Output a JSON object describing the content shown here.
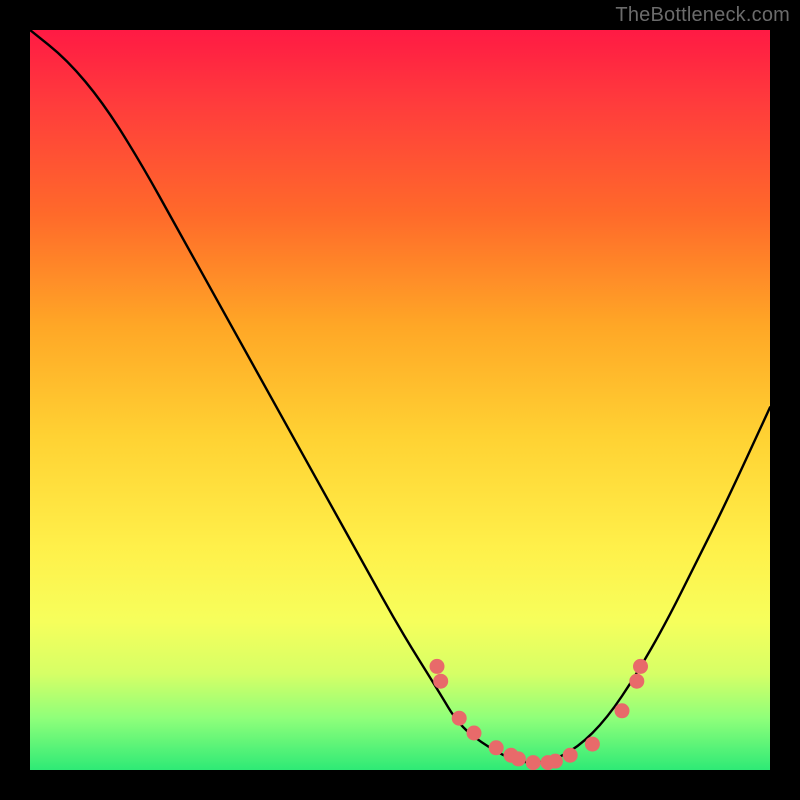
{
  "watermark": "TheBottleneck.com",
  "chart_data": {
    "type": "line",
    "title": "",
    "xlabel": "",
    "ylabel": "",
    "xlim": [
      0,
      100
    ],
    "ylim": [
      0,
      100
    ],
    "series": [
      {
        "name": "curve",
        "x": [
          0,
          5,
          10,
          15,
          20,
          25,
          30,
          35,
          40,
          45,
          50,
          55,
          58,
          62,
          66,
          70,
          74,
          78,
          82,
          86,
          90,
          94,
          100
        ],
        "values": [
          100,
          96,
          90,
          82,
          73,
          64,
          55,
          46,
          37,
          28,
          19,
          11,
          6,
          3,
          1,
          1,
          3,
          7,
          13,
          20,
          28,
          36,
          49
        ]
      }
    ],
    "markers": {
      "name": "dots",
      "color": "#e86a6a",
      "x": [
        55,
        55.5,
        58,
        60,
        63,
        65,
        66,
        68,
        70,
        71,
        73,
        76,
        80,
        82,
        82.5
      ],
      "values": [
        14,
        12,
        7,
        5,
        3,
        2,
        1.5,
        1,
        1,
        1.2,
        2,
        3.5,
        8,
        12,
        14
      ]
    }
  }
}
